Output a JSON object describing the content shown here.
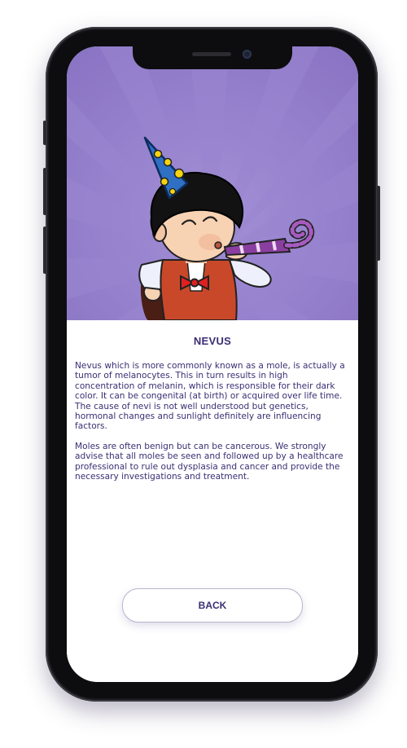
{
  "article": {
    "title": "NEVUS",
    "paragraphs": [
      "Nevus which is more commonly known as a mole, is actually a tumor of melanocytes. This in turn results in high concentration of melanin, which is responsible for their dark color. It can be congenital (at birth) or acquired over life time. The cause of nevi is not well understood but genetics, hormonal changes and sunlight definitely are influencing factors.",
      "Moles are often benign but can be cancerous. We strongly advise that all moles be seen and followed up by a healthcare professional to rule out dysplasia and cancer and provide the necessary investigations and treatment."
    ]
  },
  "actions": {
    "back_label": "BACK"
  },
  "hero": {
    "illustration": "party-boy-with-party-horn",
    "background_color": "#8e79c6"
  },
  "colors": {
    "accent": "#3b2e73",
    "hero_purple": "#8e79c6"
  }
}
